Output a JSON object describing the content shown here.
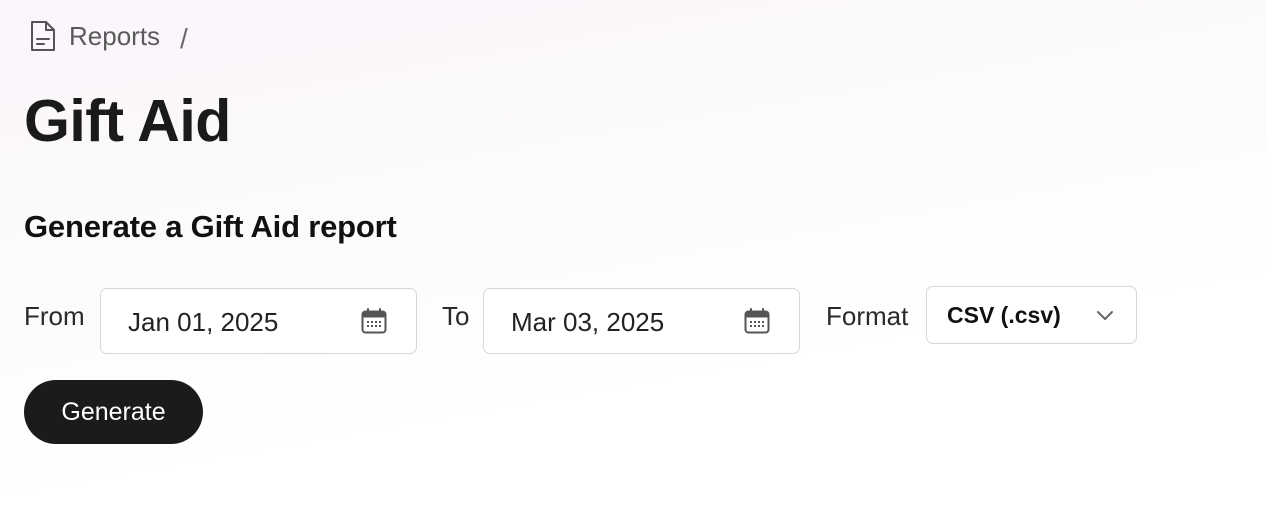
{
  "breadcrumb": {
    "icon": "document-icon",
    "link_label": "Reports",
    "separator": "/"
  },
  "page": {
    "title": "Gift Aid",
    "section_title": "Generate a Gift Aid report"
  },
  "form": {
    "from": {
      "label": "From",
      "value": "Jan 01, 2025",
      "icon": "calendar-icon"
    },
    "to": {
      "label": "To",
      "value": "Mar 03, 2025",
      "icon": "calendar-icon"
    },
    "format": {
      "label": "Format",
      "selected": "CSV (.csv)",
      "icon": "chevron-down-icon"
    },
    "generate_label": "Generate"
  },
  "colors": {
    "button_bg": "#1b1b1b",
    "button_text": "#ffffff",
    "title_text": "#1a1a1a",
    "input_border": "#d7d7d7",
    "icon_gray": "#555555"
  }
}
